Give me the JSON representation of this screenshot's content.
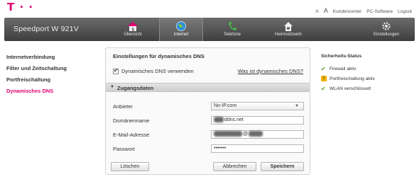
{
  "header": {
    "logo": "T · ·",
    "links": [
      "A",
      "A",
      "Kundencenter",
      "PC-Software",
      "Logout"
    ]
  },
  "nav": {
    "brand": "Speedport W 921V",
    "items": [
      {
        "label": "Übersicht",
        "icon": "home-icon"
      },
      {
        "label": "Internet",
        "icon": "globe-icon",
        "active": true
      },
      {
        "label": "Telefonie",
        "icon": "phone-icon"
      },
      {
        "label": "Heimnetzwerk",
        "icon": "house-network-icon"
      },
      {
        "label": "Einstellungen",
        "icon": "gear-icon"
      }
    ]
  },
  "sidebar": {
    "items": [
      {
        "label": "Internetverbindung"
      },
      {
        "label": "Filter und Zeitschaltung"
      },
      {
        "label": "Portfreischaltung"
      },
      {
        "label": "Dynamisches DNS",
        "active": true
      }
    ]
  },
  "main": {
    "title": "Einstellungen für dynamisches DNS",
    "use_ddns_label": "Dynamisches DNS verwenden",
    "use_ddns_checked": true,
    "help_link": "Was ist dynamisches DNS?",
    "section": "Zugangsdaten",
    "fields": {
      "provider_label": "Anbieter",
      "provider_value": "No-IP.com",
      "domain_label": "Domänenname",
      "domain_value": "ddns.net",
      "email_label": "E-Mail-Adresse",
      "email_value": "@",
      "password_label": "Passwort",
      "password_value": "•••••••"
    },
    "buttons": {
      "delete": "Löschen",
      "cancel": "Abbrechen",
      "save": "Speichern"
    }
  },
  "status": {
    "title": "Sicherheits-Status",
    "items": [
      {
        "label": "Firewall aktiv",
        "icon": "check-icon"
      },
      {
        "label": "Portfreischaltung aktiv",
        "icon": "warning-icon"
      },
      {
        "label": "WLAN verschlüsselt",
        "icon": "check-icon"
      }
    ]
  },
  "colors": {
    "accent": "#e20074",
    "navbar": "#4f4f4f",
    "ok": "#5b9b22",
    "warn": "#f2b400"
  }
}
